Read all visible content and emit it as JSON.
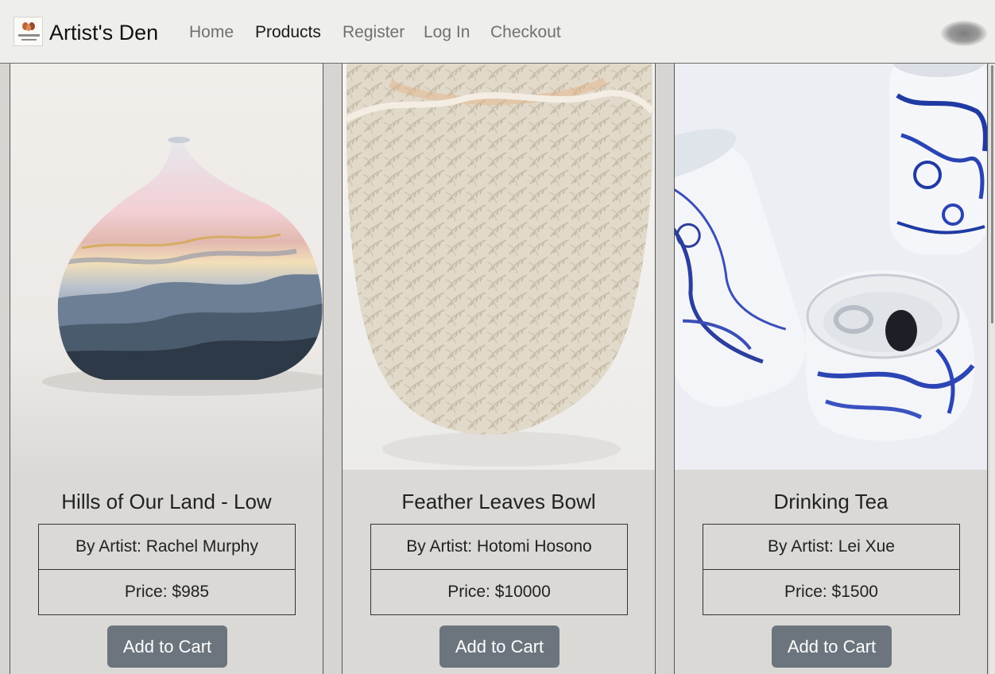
{
  "nav": {
    "brand": "Artist's Den",
    "logo_icon": "pottery-logo-icon",
    "links": [
      "Home",
      "Products",
      "Register",
      "Log In",
      "Checkout"
    ],
    "active": "Products"
  },
  "products": [
    {
      "title": "Hills of Our Land - Low",
      "artist": "By Artist: Rachel Murphy",
      "price": "Price: $985",
      "button": "Add to Cart",
      "image": "painted-round-vase-image"
    },
    {
      "title": "Feather Leaves Bowl",
      "artist": "By Artist: Hotomi Hosono",
      "price": "Price: $10000",
      "button": "Add to Cart",
      "image": "carved-white-leaf-bowl-image"
    },
    {
      "title": "Drinking Tea",
      "artist": "By Artist: Lei Xue",
      "price": "Price: $1500",
      "button": "Add to Cart",
      "image": "blue-white-porcelain-cans-image"
    }
  ],
  "colors": {
    "button": "#6c757d",
    "card_bg": "#dad9d5",
    "nav_bg": "#eeeeec"
  }
}
